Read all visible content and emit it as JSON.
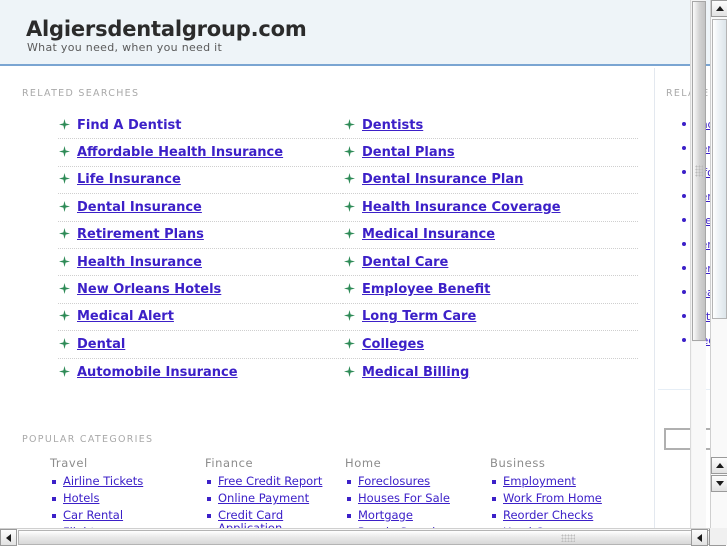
{
  "header": {
    "title": "Algiersdentalgroup.com",
    "tagline": "What you need, when you need it",
    "accent_color": "#7aa5d2",
    "background_color": "#eef4f8"
  },
  "colors": {
    "link": "#3c20c8",
    "label": "#a9a9a9",
    "icon_green": "#2e8b57",
    "divider": "#cfcfcf"
  },
  "related_searches": {
    "label": "RELATED SEARCHES",
    "icon_name": "green-star-bullet-icon",
    "left_column": [
      {
        "label": "Find A Dentist",
        "underlined": false
      },
      {
        "label": "Affordable Health Insurance",
        "underlined": true
      },
      {
        "label": "Life Insurance",
        "underlined": true
      },
      {
        "label": "Dental Insurance",
        "underlined": true
      },
      {
        "label": "Retirement Plans",
        "underlined": true
      },
      {
        "label": "Health Insurance",
        "underlined": true
      },
      {
        "label": "New Orleans Hotels",
        "underlined": true
      },
      {
        "label": "Medical Alert",
        "underlined": true
      },
      {
        "label": "Dental",
        "underlined": true
      },
      {
        "label": "Automobile Insurance",
        "underlined": true
      }
    ],
    "right_column": [
      {
        "label": "Dentists",
        "underlined": true
      },
      {
        "label": "Dental Plans",
        "underlined": true
      },
      {
        "label": "Dental Insurance Plan",
        "underlined": true
      },
      {
        "label": "Health Insurance Coverage",
        "underlined": true
      },
      {
        "label": "Medical Insurance",
        "underlined": true
      },
      {
        "label": "Dental Care",
        "underlined": true
      },
      {
        "label": "Employee Benefit",
        "underlined": true
      },
      {
        "label": "Long Term Care",
        "underlined": true
      },
      {
        "label": "Colleges",
        "underlined": true
      },
      {
        "label": "Medical Billing",
        "underlined": true
      }
    ]
  },
  "popular_categories": {
    "label": "POPULAR CATEGORIES",
    "columns": [
      {
        "heading": "Travel",
        "items": [
          "Airline Tickets",
          "Hotels",
          "Car Rental",
          "Flights"
        ]
      },
      {
        "heading": "Finance",
        "items": [
          "Free Credit Report",
          "Online Payment",
          "Credit Card Application"
        ]
      },
      {
        "heading": "Home",
        "items": [
          "Foreclosures",
          "Houses For Sale",
          "Mortgage",
          "People Search"
        ]
      },
      {
        "heading": "Business",
        "items": [
          "Employment",
          "Work From Home",
          "Reorder Checks",
          "Used Cars"
        ]
      }
    ]
  },
  "right_rail": {
    "label": "RELATED",
    "items": [
      "Find A Dentist",
      "Dentists",
      "Affordable Health Insurance",
      "Dental Plans",
      "Life Insurance",
      "Dental Insurance Plan",
      "Dental Insurance",
      "Health Insurance Coverage",
      "Retirement Plans",
      "Medical Insurance"
    ],
    "search_value": "",
    "search_placeholder": ""
  },
  "scrollbars": {
    "outer_vertical_up": "▲",
    "outer_vertical_down": "▼",
    "outer_horizontal_left": "◄",
    "outer_horizontal_right": "►"
  }
}
